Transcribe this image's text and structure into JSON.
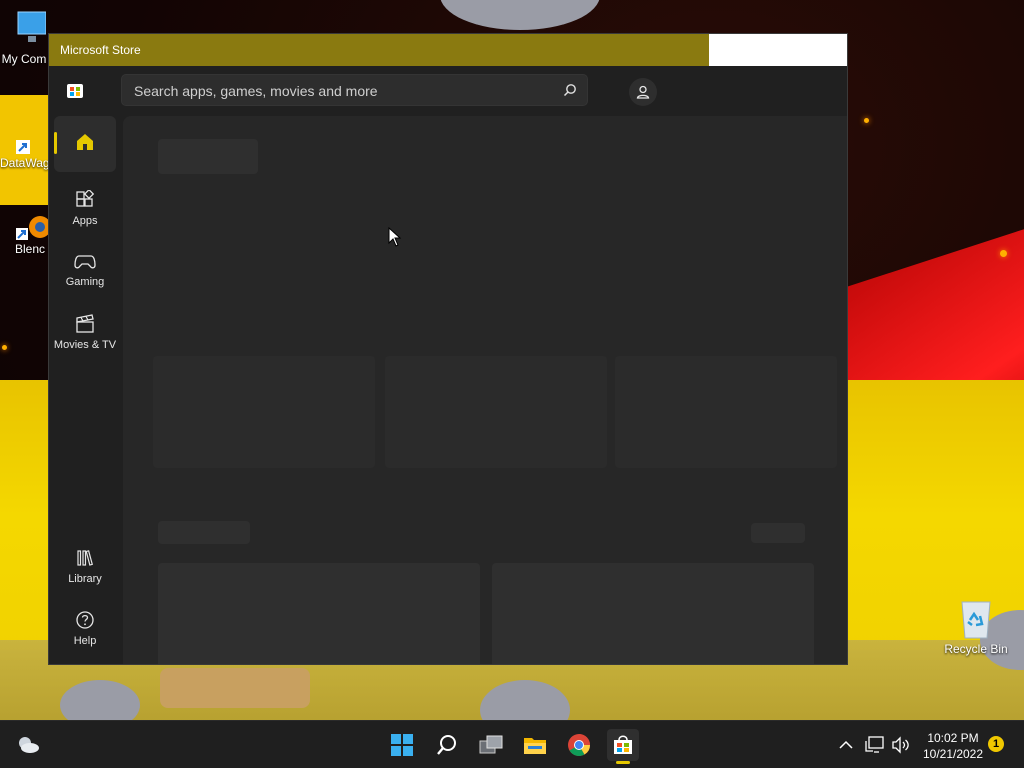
{
  "window": {
    "title": "Microsoft Store"
  },
  "search": {
    "placeholder": "Search apps, games, movies and more"
  },
  "sidebar": {
    "items": [
      {
        "label": ""
      },
      {
        "label": "Apps"
      },
      {
        "label": "Gaming"
      },
      {
        "label": "Movies & TV"
      },
      {
        "label": "Library"
      },
      {
        "label": "Help"
      }
    ]
  },
  "desktop": {
    "icons": [
      {
        "label": "My Com"
      },
      {
        "label": "DataWag"
      },
      {
        "label": "Blenc"
      },
      {
        "label": "Recycle Bin"
      }
    ]
  },
  "taskbar": {
    "time": "10:02 PM",
    "date": "10/21/2022",
    "notification_count": "1"
  },
  "colors": {
    "accent": "#e5c800",
    "titlebar": "#8a7a10",
    "window_bg": "#202020",
    "content_bg": "#272727"
  }
}
